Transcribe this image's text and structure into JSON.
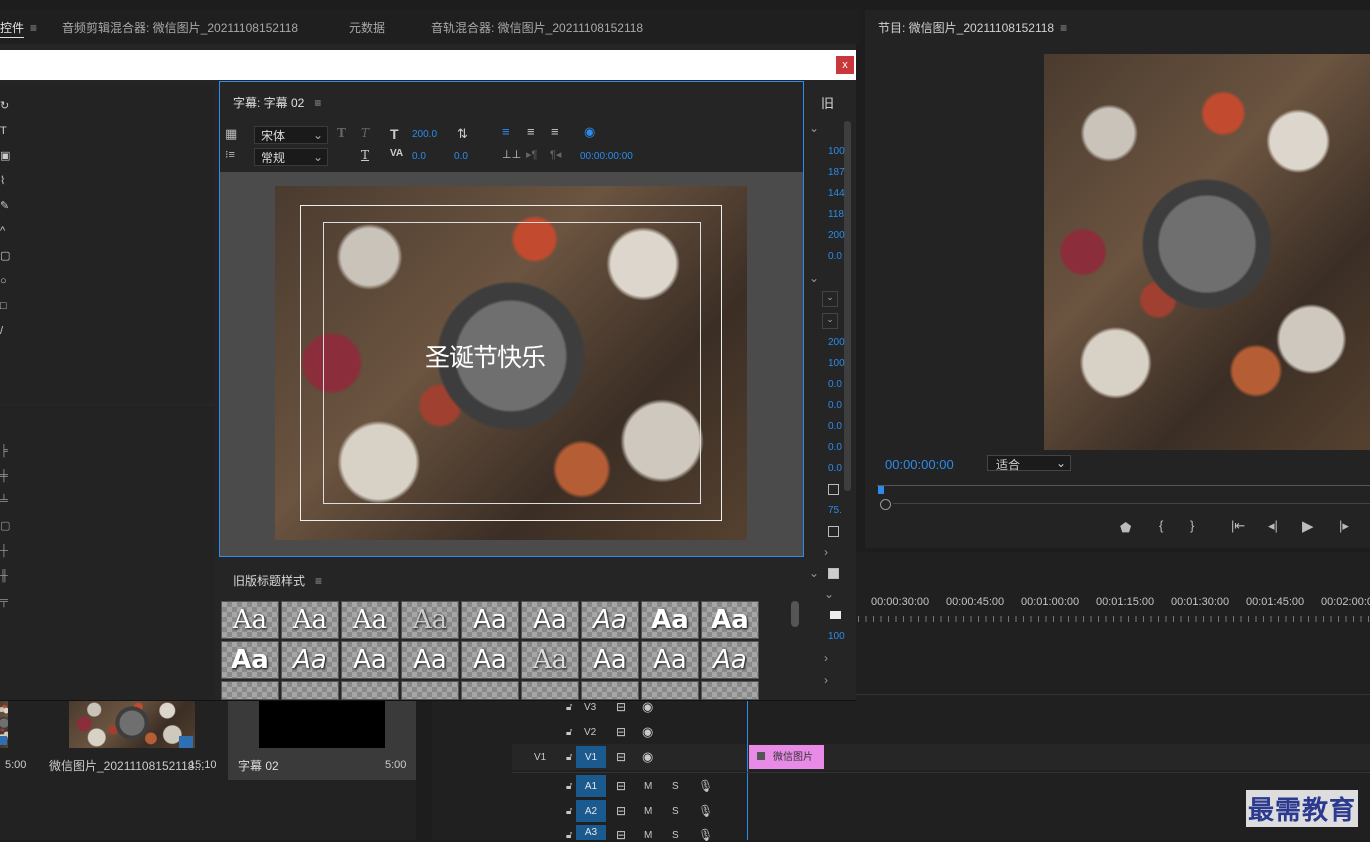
{
  "top_tabs": {
    "effects_controls": "控件",
    "audio_clip_mixer": "音频剪辑混合器: 微信图片_20211108152118",
    "metadata": "元数据",
    "audio_track_mixer": "音轨混合器: 微信图片_20211108152118"
  },
  "program_monitor": {
    "title": "节目: 微信图片_20211108152118",
    "timecode": "00:00:00:00",
    "fit_label": "适合"
  },
  "title_window": {
    "close_label": "x",
    "legacy_label": "旧",
    "title_panel": {
      "title": "字幕: 字幕 02",
      "font_family": "宋体",
      "font_style": "常规",
      "font_size": "200.0",
      "kerning": "0.0",
      "leading": "0.0",
      "tab_time": "00:00:00:00",
      "caption_text": "圣诞节快乐"
    },
    "styles_panel": {
      "title": "旧版标题样式",
      "sample": "Aa"
    },
    "properties": [
      "100",
      "187",
      "144",
      "118",
      "200",
      "0.0",
      "200",
      "100",
      "0.0",
      "0.0",
      "0.0",
      "0.0",
      "0.0",
      "75.",
      "100"
    ]
  },
  "project_panel": {
    "items": [
      {
        "name": "",
        "duration": "5:00"
      },
      {
        "name": "微信图片_20211108152118...",
        "duration": "15:10"
      },
      {
        "name": "字幕 02",
        "duration": "5:00"
      }
    ]
  },
  "timeline": {
    "ruler": [
      "00:00:30:00",
      "00:00:45:00",
      "00:01:00:00",
      "00:01:15:00",
      "00:01:30:00",
      "00:01:45:00",
      "00:02:00:0"
    ],
    "video_tracks": [
      "V3",
      "V2",
      "V1"
    ],
    "source_patch": "V1",
    "audio_tracks": [
      "A1",
      "A2",
      "A3"
    ],
    "mute": "M",
    "solo": "S",
    "clip_label": "微信图片"
  },
  "watermark": "最需教育",
  "colors": {
    "accent": "#2d8ceb",
    "clip": "#e88be6",
    "track_target": "#1b5a8f"
  }
}
